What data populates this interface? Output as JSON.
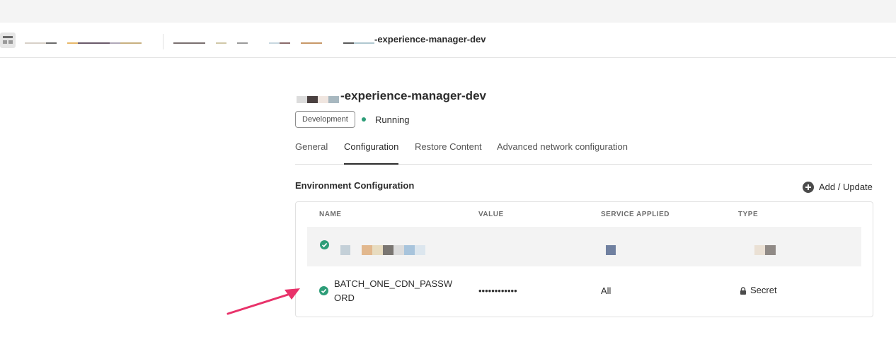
{
  "breadcrumb": {
    "current": "-experience-manager-dev"
  },
  "environment": {
    "title": "-experience-manager-dev",
    "tag": "Development",
    "status": "Running",
    "status_color": "#2d9d78"
  },
  "tabs": [
    {
      "label": "General",
      "selected": false
    },
    {
      "label": "Configuration",
      "selected": true
    },
    {
      "label": "Restore Content",
      "selected": false
    },
    {
      "label": "Advanced network configuration",
      "selected": false
    }
  ],
  "section": {
    "title": "Environment Configuration",
    "add_update_label": "Add / Update"
  },
  "table": {
    "columns": [
      "NAME",
      "VALUE",
      "SERVICE APPLIED",
      "TYPE"
    ],
    "rows": [
      {
        "name": "",
        "value": "",
        "service": "",
        "type": "",
        "status": "check-icon"
      },
      {
        "name": "BATCH_ONE_CDN_PASSWORD",
        "value": "••••••••••••",
        "service": "All",
        "type": "Secret",
        "type_icon": "lock-icon",
        "status": "check-icon"
      }
    ]
  },
  "colors": {
    "accent_green": "#2d9d78",
    "annotation_arrow": "#e8326a"
  }
}
